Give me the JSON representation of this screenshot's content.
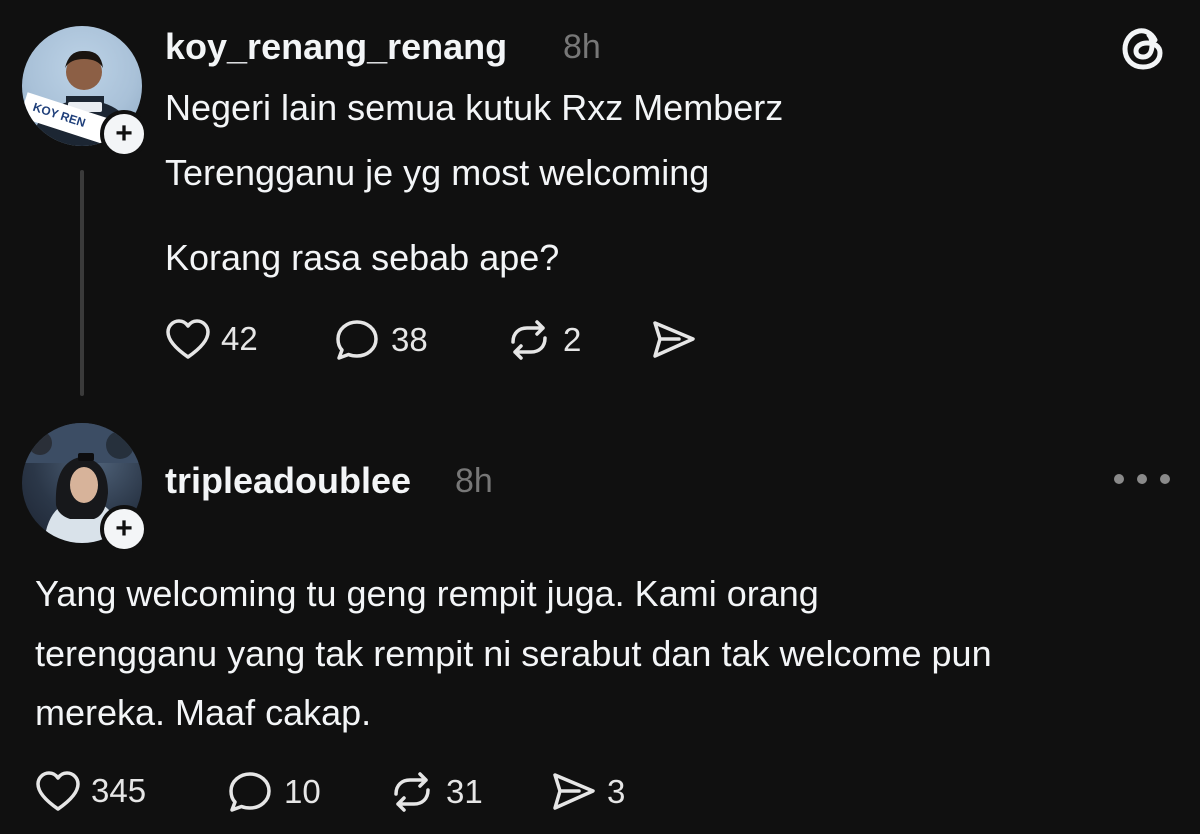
{
  "app_icon": "threads-logo-icon",
  "post": {
    "username": "koy_renang_renang",
    "time": "8h",
    "avatar_text": "KOY REN",
    "lines": [
      "Negeri lain semua kutuk Rxz Memberz",
      "Terengganu je yg most welcoming",
      "",
      "Korang rasa sebab ape?"
    ],
    "likes": "42",
    "replies": "38",
    "reposts": "2"
  },
  "reply": {
    "username": "tripleadoublee",
    "time": "8h",
    "lines": [
      "Yang welcoming tu geng rempit juga. Kami orang",
      "terengganu yang tak rempit ni serabut dan tak welcome pun",
      "mereka. Maaf cakap."
    ],
    "likes": "345",
    "replies": "10",
    "reposts": "31",
    "shares": "3"
  },
  "follow_symbol": "+"
}
